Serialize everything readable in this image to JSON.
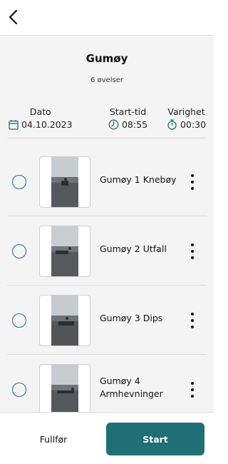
{
  "header": {
    "back_icon": "chevron-left-icon"
  },
  "workout": {
    "title": "Gumøy",
    "exercise_count": "6 øvelser"
  },
  "meta": {
    "date": {
      "label": "Dato",
      "value": "04.10.2023",
      "icon": "calendar-icon"
    },
    "start_time": {
      "label": "Start-tid",
      "value": "08:55",
      "icon": "clock-icon"
    },
    "duration": {
      "label": "Varighet",
      "value": "00:30",
      "icon": "stopwatch-icon"
    }
  },
  "exercises": [
    {
      "name": "Gumøy 1 Knebøy",
      "checked": false
    },
    {
      "name": "Gumøy 2 Utfall",
      "checked": false
    },
    {
      "name": "Gumøy 3 Dips",
      "checked": false
    },
    {
      "name": "Gumøy 4 Armhevninger",
      "checked": false
    }
  ],
  "footer": {
    "finish_label": "Fullfør",
    "start_label": "Start"
  },
  "colors": {
    "accent": "#1f6f77",
    "background": "#f4f4f4"
  }
}
